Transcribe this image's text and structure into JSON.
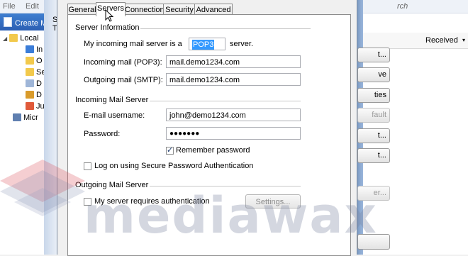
{
  "background": {
    "menu": [
      "File",
      "Edit"
    ],
    "create_label": "Create M",
    "search_hint": "rch",
    "tree": [
      {
        "label": "Local",
        "color": "#f2c94c"
      },
      {
        "label": "In",
        "color": "#3b7dd8"
      },
      {
        "label": "O",
        "color": "#f2c94c"
      },
      {
        "label": "Se",
        "color": "#f2c94c"
      },
      {
        "label": "D",
        "color": "#9fb6d8"
      },
      {
        "label": "D",
        "color": "#d99b2b"
      },
      {
        "label": "Ju",
        "color": "#e05a3a"
      },
      {
        "label": "Micr",
        "color": "#5f7fb0"
      }
    ],
    "column_header": "Received",
    "side_buttons": [
      "t...",
      "ve",
      "ties",
      "fault",
      "t...",
      "t...",
      "er..."
    ],
    "left_strip": [
      "S",
      "T"
    ]
  },
  "dialog": {
    "tabs": [
      "General",
      "Servers",
      "Connection",
      "Security",
      "Advanced"
    ],
    "active_tab": "Servers",
    "server_info_title": "Server Information",
    "server_type_prefix": "My incoming mail server is a",
    "server_type_value": "POP3",
    "server_type_suffix": "server.",
    "incoming_label": "Incoming mail (POP3):",
    "incoming_value": "mail.demo1234.com",
    "outgoing_label": "Outgoing mail (SMTP):",
    "outgoing_value": "mail.demo1234.com",
    "incoming_server_title": "Incoming Mail Server",
    "username_label": "E-mail username:",
    "username_value": "john@demo1234.com",
    "password_label": "Password:",
    "password_value": "●●●●●●●",
    "remember_label": "Remember password",
    "remember_checked": true,
    "spa_label": "Log on using Secure Password Authentication",
    "spa_checked": false,
    "outgoing_server_title": "Outgoing Mail Server",
    "auth_label": "My server requires authentication",
    "auth_checked": false,
    "settings_button": "Settings..."
  },
  "watermark": "mediawax"
}
